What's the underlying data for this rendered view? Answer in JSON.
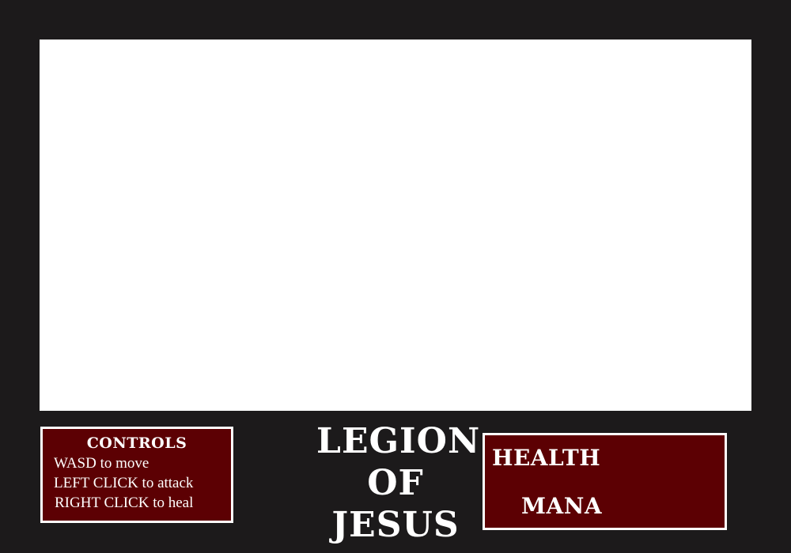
{
  "controls": {
    "title": "CONTROLS",
    "lines": [
      "WASD to move",
      "LEFT CLICK to attack",
      "RIGHT CLICK to heal"
    ]
  },
  "title": {
    "lines": [
      "LEGION",
      "OF",
      "JESUS"
    ]
  },
  "stats": {
    "health_label": "HEALTH",
    "mana_label": "MANA"
  },
  "colors": {
    "background": "#1c1a1b",
    "panel": "#5c0003",
    "canvas": "#ffffff",
    "text": "#ffffff"
  }
}
